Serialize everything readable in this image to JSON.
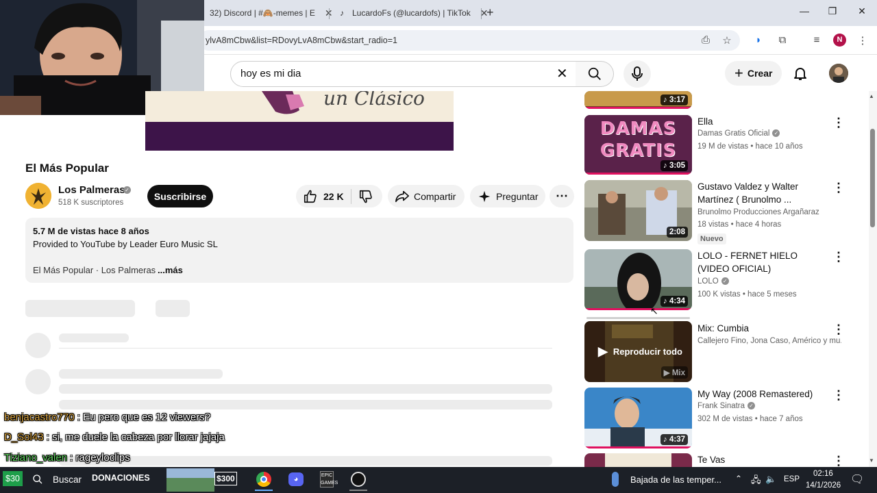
{
  "browser": {
    "tabs": [
      {
        "label": "32) Discord | #🙈-memes | E"
      },
      {
        "label": "LucardoFs (@lucardofs) | TikTok"
      }
    ],
    "url": "ylvA8mCbw&list=RDovyLvA8mCbw&start_radio=1",
    "profile_initial": "N"
  },
  "youtube": {
    "search_query": "hoy es mi dia",
    "create_label": "Crear"
  },
  "video": {
    "thumb_text": "un Clásico",
    "title": "El Más Popular",
    "channel": "Los Palmeras",
    "subscribers": "518 K suscriptores",
    "subscribe_label": "Suscribirse",
    "likes": "22 K",
    "share_label": "Compartir",
    "ask_label": "Preguntar",
    "description": {
      "views_date": "5.7 M de vistas  hace 8 años",
      "line1": "Provided to YouTube by Leader Euro Music SL",
      "line2": "El Más Popular · Los Palmeras",
      "more": "...más"
    }
  },
  "recommendations": [
    {
      "duration": "3:17"
    },
    {
      "title": "Ella",
      "channel": "Damas Gratis Oficial",
      "meta": "19 M de vistas • hace 10 años",
      "duration": "3:05",
      "thumb_text": "DAMAS GRATIS"
    },
    {
      "title": "Gustavo Valdez  y Walter Martínez ( Brunolmo ...",
      "channel": "Brunolmo Producciones Argañaraz",
      "meta": "18 vistas • hace 4 horas",
      "badge": "Nuevo",
      "duration": "2:08"
    },
    {
      "title": "LOLO - FERNET HIELO (VIDEO OFICIAL)",
      "channel": "LOLO",
      "meta": "100 K vistas • hace 5 meses",
      "duration": "4:34"
    },
    {
      "title": "Mix: Cumbia",
      "channel": "Callejero Fino, Jona Caso, Américo y mu...",
      "overlay": "Reproducir todo",
      "mix_label": "Mix"
    },
    {
      "title": "My Way (2008 Remastered)",
      "channel": "Frank Sinatra",
      "meta": "302 M de vistas • hace 7 años",
      "duration": "4:37"
    },
    {
      "title": "Te Vas"
    }
  ],
  "chat": [
    {
      "user": "benjacastro770",
      "user_color": "#d9a441",
      "message": "Eu pero que es 12 viewers?"
    },
    {
      "user": "D_Sol43",
      "user_color": "#d9a441",
      "message": "si, me duele la cabeza por llorar jajaja"
    },
    {
      "user": "Tiziano_valen",
      "user_color": "#5fd35f",
      "message": "rageyloclips"
    }
  ],
  "taskbar": {
    "badge1": "$30",
    "search_label": "Buscar",
    "donations_label": "DONACIONES",
    "badge2": "$300",
    "weather": "Bajada de las temper...",
    "language": "ESP",
    "time": "02:16",
    "date": "14/1/2026"
  },
  "colors": {
    "accent_red": "#e0115f",
    "subscribe_bg": "#0f0f0f",
    "taskbar_bg": "#1c2027"
  }
}
